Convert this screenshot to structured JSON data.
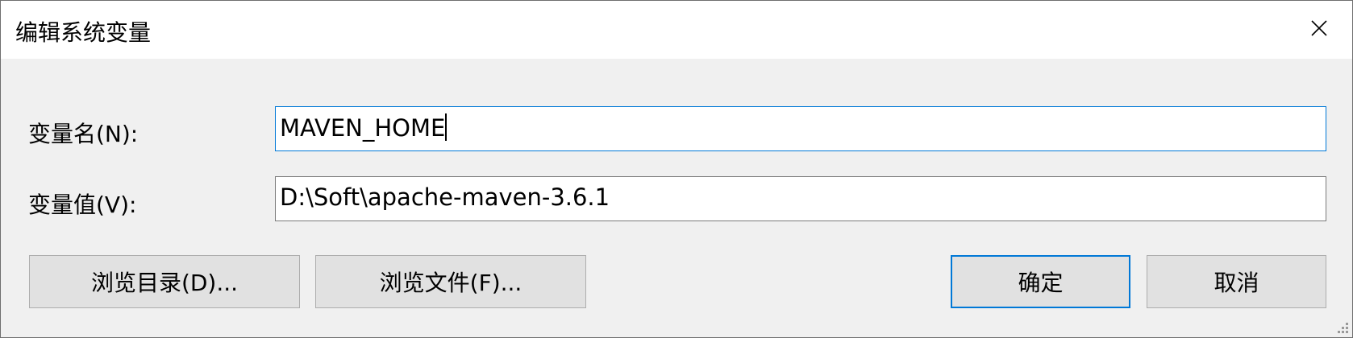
{
  "window": {
    "title": "编辑系统变量",
    "close_icon": "close-icon"
  },
  "form": {
    "name_label": "变量名(N):",
    "name_value": "MAVEN_HOME",
    "value_label": "变量值(V):",
    "value_value": "D:\\Soft\\apache-maven-3.6.1"
  },
  "buttons": {
    "browse_dir": "浏览目录(D)...",
    "browse_file": "浏览文件(F)...",
    "ok": "确定",
    "cancel": "取消"
  },
  "colors": {
    "accent": "#0078d7",
    "dialog_bg": "#f0f0f0",
    "titlebar_bg": "#ffffff",
    "button_bg": "#e1e1e1"
  }
}
